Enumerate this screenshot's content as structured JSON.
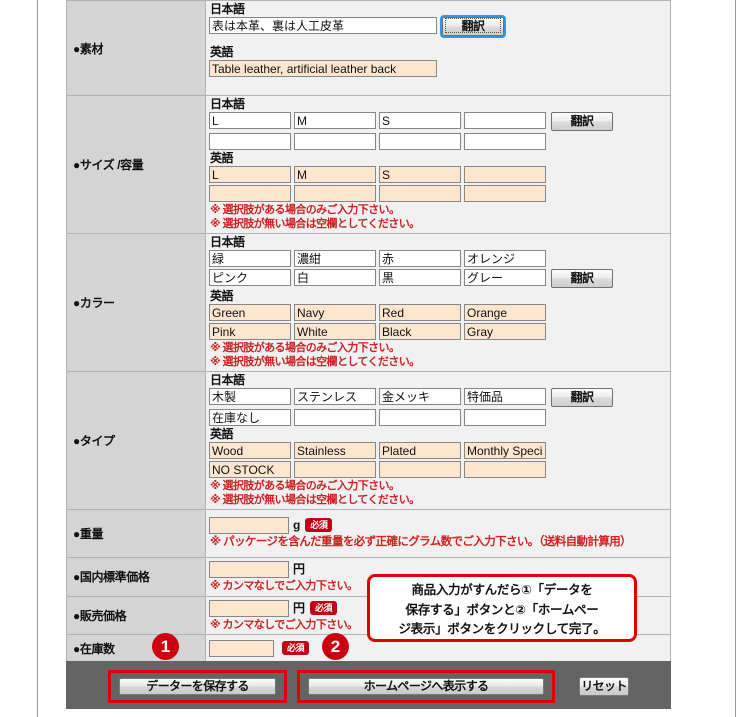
{
  "form": {
    "lang_labels": {
      "ja": "日本語",
      "en": "英語"
    },
    "translate_button": "翻訳",
    "notes": {
      "choices_only": "※ 選択肢がある場合のみご入力下さい。",
      "blank_if_none": "※ 選択肢が無い場合は空欄としてください。",
      "no_comma": "※ カンマなしでご入力下さい。",
      "weight_note": "※ パッケージを含んだ重量を必ず正確にグラム数でご入力下さい。（送料自動計算用）"
    },
    "required_badge": "必須",
    "rows": [
      {
        "label": "●素材",
        "ja_values": [
          "表は本革、裏は人工皮革"
        ],
        "en_values": [
          "Table leather, artificial leather back"
        ]
      },
      {
        "label": "●サイズ /容量",
        "ja_values": [
          "L",
          "M",
          "S",
          "",
          "",
          "",
          "",
          ""
        ],
        "en_values": [
          "L",
          "M",
          "S",
          "",
          "",
          "",
          "",
          ""
        ]
      },
      {
        "label": "●カラー",
        "ja_values": [
          "緑",
          "濃紺",
          "赤",
          "オレンジ",
          "ピンク",
          "白",
          "黒",
          "グレー"
        ],
        "en_values": [
          "Green",
          "Navy",
          "Red",
          "Orange",
          "Pink",
          "White",
          "Black",
          "Gray"
        ]
      },
      {
        "label": "●タイプ",
        "ja_values": [
          "木製",
          "ステンレス",
          "金メッキ",
          "特価品",
          "在庫なし",
          "",
          "",
          ""
        ],
        "en_values": [
          "Wood",
          "Stainless",
          "Plated",
          "Monthly Specia",
          "NO STOCK",
          "",
          "",
          ""
        ]
      }
    ],
    "weight": {
      "label": "●重量",
      "value": "",
      "unit": "g"
    },
    "domestic_price": {
      "label": "●国内標準価格",
      "value": "",
      "unit": "円"
    },
    "sale_price": {
      "label": "●販売価格",
      "value": "",
      "unit": "円"
    },
    "stock": {
      "label": "●在庫数",
      "value": ""
    }
  },
  "callout": {
    "line1": "商品入力がすんだら①「データを",
    "line2": "保存する」ボタンと②「ホームペー",
    "line3": "ジ表示」ボタンをクリックして完了。"
  },
  "markers": {
    "one": "1",
    "two": "2"
  },
  "actions": {
    "save": "データーを保存する",
    "publish": "ホームページへ表示する",
    "reset": "リセット"
  },
  "colors": {
    "highlight_red": "#e00000",
    "marker_red": "#cc0011",
    "required_red": "#c00014",
    "note_red": "#cc2222",
    "en_field_bg": "#fce6d0",
    "label_bg": "#d4d4d4",
    "actionbar_bg": "#646464"
  }
}
